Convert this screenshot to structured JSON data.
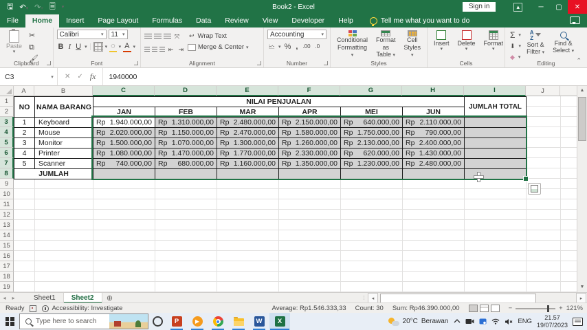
{
  "titlebar": {
    "title": "Book2 - Excel",
    "sign_in": "Sign in",
    "qat_icons": [
      "save-icon",
      "undo-icon",
      "redo-icon",
      "print-preview-icon",
      "customize-qat-icon"
    ]
  },
  "ribbon_tabs": [
    "File",
    "Home",
    "Insert",
    "Page Layout",
    "Formulas",
    "Data",
    "Review",
    "View",
    "Developer",
    "Help"
  ],
  "active_tab": "Home",
  "tell_me": "Tell me what you want to do",
  "ribbon": {
    "clipboard": {
      "label": "Clipboard",
      "paste": "Paste"
    },
    "font": {
      "label": "Font",
      "font_name": "Calibri",
      "font_size": "11",
      "bold": "B",
      "italic": "I",
      "underline": "U"
    },
    "alignment": {
      "label": "Alignment",
      "wrap_text": "Wrap Text",
      "merge_center": "Merge & Center"
    },
    "number": {
      "label": "Number",
      "format": "Accounting",
      "percent": "%",
      "comma": ",",
      "inc_dec": ".00",
      "dec_dec": ".0"
    },
    "styles": {
      "label": "Styles",
      "conditional_l1": "Conditional",
      "conditional_l2": "Formatting",
      "format_table_l1": "Format as",
      "format_table_l2": "Table",
      "cell_styles_l1": "Cell",
      "cell_styles_l2": "Styles"
    },
    "cells": {
      "label": "Cells",
      "insert": "Insert",
      "delete": "Delete",
      "format": "Format"
    },
    "editing": {
      "label": "Editing",
      "autosum": "Σ",
      "sort_l1": "Sort &",
      "sort_l2": "Filter",
      "find_l1": "Find &",
      "find_l2": "Select",
      "az": "A",
      "za": "Z"
    }
  },
  "formula_bar": {
    "name_box": "C3",
    "fx": "fx",
    "value": "1940000"
  },
  "sheet": {
    "columns": [
      "A",
      "B",
      "C",
      "D",
      "E",
      "F",
      "G",
      "H",
      "I",
      "J"
    ],
    "selected_columns": [
      "C",
      "D",
      "E",
      "F",
      "G",
      "H",
      "I"
    ],
    "visible_rows": 19,
    "selected_rows_from": 3,
    "selected_rows_to": 8,
    "selection": {
      "range": "C3:I8",
      "active_cell": "C3"
    },
    "table": {
      "title": "NILAI PENJUALAN",
      "col_no": "NO",
      "col_name": "NAMA BARANG",
      "col_total": "JUMLAH TOTAL",
      "months": [
        "JAN",
        "FEB",
        "MAR",
        "APR",
        "MEI",
        "JUN"
      ],
      "currency": "Rp",
      "items": [
        {
          "no": "1",
          "name": "Keyboard",
          "values": [
            "1.940.000,00",
            "1.310.000,00",
            "2.480.000,00",
            "2.150.000,00",
            "640.000,00",
            "2.110.000,00"
          ]
        },
        {
          "no": "2",
          "name": "Mouse",
          "values": [
            "2.020.000,00",
            "1.150.000,00",
            "2.470.000,00",
            "1.580.000,00",
            "1.750.000,00",
            "790.000,00"
          ]
        },
        {
          "no": "3",
          "name": "Monitor",
          "values": [
            "1.500.000,00",
            "1.070.000,00",
            "1.300.000,00",
            "1.260.000,00",
            "2.130.000,00",
            "2.400.000,00"
          ]
        },
        {
          "no": "4",
          "name": "Printer",
          "values": [
            "1.080.000,00",
            "1.470.000,00",
            "1.770.000,00",
            "2.330.000,00",
            "620.000,00",
            "1.430.000,00"
          ]
        },
        {
          "no": "5",
          "name": "Scanner",
          "values": [
            "740.000,00",
            "680.000,00",
            "1.160.000,00",
            "1.350.000,00",
            "1.230.000,00",
            "2.480.000,00"
          ]
        }
      ],
      "footer_label": "JUMLAH"
    }
  },
  "sheet_tabs": {
    "tabs": [
      "Sheet1",
      "Sheet2"
    ],
    "active": "Sheet2"
  },
  "status_bar": {
    "mode": "Ready",
    "accessibility": "Accessibility: Investigate",
    "average": "Average: Rp1.546.333,33",
    "count": "Count: 30",
    "sum": "Sum: Rp46.390.000,00",
    "zoom": "121%"
  },
  "taskbar": {
    "search_placeholder": "Type here to search",
    "weather_temp": "20°C",
    "weather_desc": "Berawan",
    "language": "ENG",
    "time": "21.57",
    "date": "19/07/2023",
    "app_icons": [
      "powerpoint-icon",
      "media-player-icon",
      "chrome-icon",
      "file-explorer-icon",
      "word-icon",
      "excel-icon"
    ]
  },
  "colors": {
    "excel_green": "#217346",
    "close_red": "#e81123",
    "selection_gray": "#d3d3d3",
    "taskbar_accent": "#2f7fd4"
  }
}
